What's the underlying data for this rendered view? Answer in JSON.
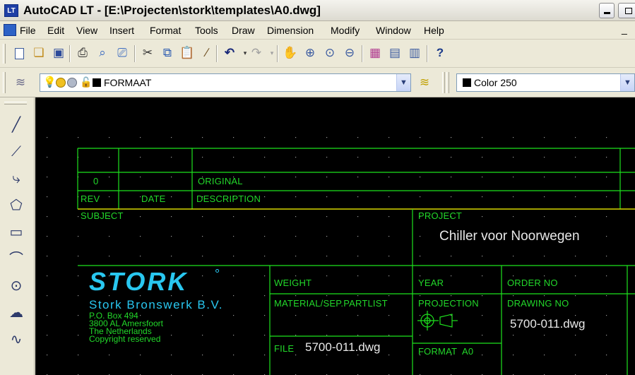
{
  "titlebar": {
    "app_icon": "LT",
    "title": "AutoCAD LT - [E:\\Projecten\\stork\\templates\\A0.dwg]",
    "minimize_icon": "minimize-icon",
    "restore_icon": "restore-icon"
  },
  "menubar": {
    "items": [
      "File",
      "Edit",
      "View",
      "Insert",
      "Format",
      "Tools",
      "Draw",
      "Dimension",
      "Modify",
      "Window",
      "Help"
    ],
    "doc_minimize": "_"
  },
  "toolbar": {
    "icons": [
      "new-icon",
      "open-icon",
      "save-icon",
      "print-icon",
      "print-preview-icon",
      "publish-icon",
      "cut-icon",
      "copy-icon",
      "paste-icon",
      "match-properties-icon",
      "undo-icon",
      "redo-icon",
      "pan-icon",
      "zoom-realtime-icon",
      "zoom-window-icon",
      "zoom-previous-icon",
      "properties-icon",
      "design-center-icon",
      "tool-palettes-icon",
      "help-icon"
    ]
  },
  "layerbar": {
    "layer_name": "FORMAAT",
    "color_name": "Color 250"
  },
  "lefttoolbar": {
    "icons": [
      "line-icon",
      "construction-line-icon",
      "polyline-icon",
      "polygon-icon",
      "rectangle-icon",
      "arc-icon",
      "circle-icon",
      "revision-cloud-icon",
      "spline-icon"
    ]
  },
  "drawing": {
    "rev_value": "0",
    "original": "ORIGINAL",
    "rev_header": "REV",
    "date_header": "DATE",
    "description_header": "DESCRIPTION",
    "subject": "SUBJECT",
    "project_label": "PROJECT",
    "project_name": "Chiller voor Noorwegen",
    "logo": "STORK",
    "logo_mark": "°",
    "weight": "WEIGHT",
    "year": "YEAR",
    "order_no": "ORDER NO",
    "company_name": "Stork Bronswerk B.V.",
    "address_line1": "P.O. Box 494",
    "address_line2": "3800 AL Amersfoort",
    "address_line3": "The Netherlands",
    "address_line4": "Copyright reserved",
    "material": "MATERIAL/SEP.PARTLIST",
    "projection": "PROJECTION",
    "drawing_no_label": "DRAWING NO",
    "drawing_no_value": "5700-011.dwg",
    "file_label": "FILE",
    "file_value": "5700-011.dwg",
    "format_label": "FORMAT",
    "format_value": "A0"
  },
  "colors": {
    "line_green": "#1ee21e",
    "line_yellow": "#d8d800",
    "logo_cyan": "#29c7f0",
    "text_white": "#e8e8e8",
    "background": "#000000"
  }
}
